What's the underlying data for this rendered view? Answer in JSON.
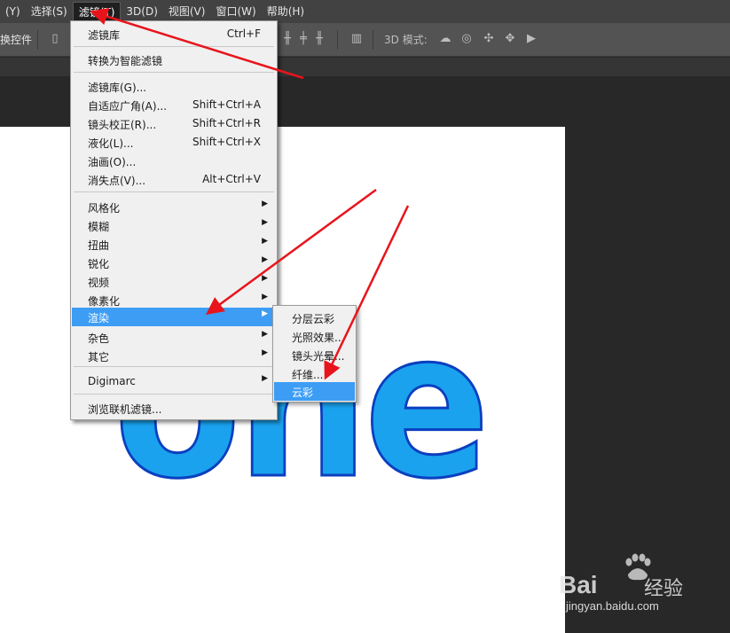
{
  "menubar": {
    "items": [
      {
        "label": "(Y)"
      },
      {
        "label": "选择(S)"
      },
      {
        "label": "滤镜(T)"
      },
      {
        "label": "3D(D)"
      },
      {
        "label": "视图(V)"
      },
      {
        "label": "窗口(W)"
      },
      {
        "label": "帮助(H)"
      }
    ]
  },
  "optionsbar": {
    "controls_label": "换控件",
    "mode_label": "3D 模式:"
  },
  "filter_menu": {
    "items": [
      {
        "label": "滤镜库",
        "shortcut": "Ctrl+F"
      },
      {
        "label": "转换为智能滤镜"
      },
      {
        "label": "滤镜库(G)..."
      },
      {
        "label": "自适应广角(A)...",
        "shortcut": "Shift+Ctrl+A"
      },
      {
        "label": "镜头校正(R)...",
        "shortcut": "Shift+Ctrl+R"
      },
      {
        "label": "液化(L)...",
        "shortcut": "Shift+Ctrl+X"
      },
      {
        "label": "油画(O)..."
      },
      {
        "label": "消失点(V)...",
        "shortcut": "Alt+Ctrl+V"
      },
      {
        "label": "风格化"
      },
      {
        "label": "模糊"
      },
      {
        "label": "扭曲"
      },
      {
        "label": "锐化"
      },
      {
        "label": "视频"
      },
      {
        "label": "像素化"
      },
      {
        "label": "渲染"
      },
      {
        "label": "杂色"
      },
      {
        "label": "其它"
      },
      {
        "label": "Digimarc"
      },
      {
        "label": "浏览联机滤镜..."
      }
    ]
  },
  "render_submenu": {
    "items": [
      {
        "label": "分层云彩"
      },
      {
        "label": "光照效果..."
      },
      {
        "label": "镜头光晕..."
      },
      {
        "label": "纤维..."
      },
      {
        "label": "云彩"
      }
    ]
  },
  "canvas": {
    "art_text": "one"
  },
  "watermark": {
    "brand": "Bai",
    "brand2": "经验",
    "url": "jingyan.baidu.com"
  },
  "colors": {
    "highlight": "#3d9df5",
    "annotation_arrow": "#e8141c",
    "art_fill": "#1aa2ee",
    "art_stroke": "#0b3fbf"
  }
}
